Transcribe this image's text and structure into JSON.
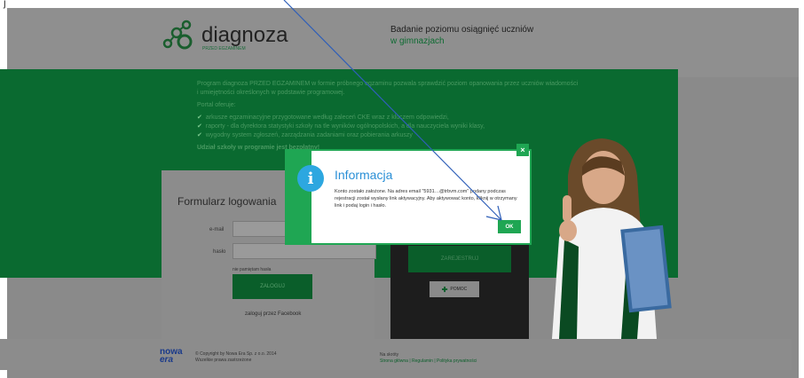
{
  "top_strip": {
    "text": "j"
  },
  "header": {
    "logo_text": "diagnoza",
    "logo_sub": "PRZED EGZAMINEM",
    "tagline_line1": "Badanie poziomu osiągnięć uczniów",
    "tagline_line2": "w gimnazjach"
  },
  "intro": {
    "line1": "Program diagnoza PRZED EGZAMINEM w formie próbnego egzaminu pozwala sprawdzić poziom opanowania przez uczniów wiadomości",
    "line2": "i umiejętności określonych w podstawie programowej.",
    "line3": "Portal oferuje:",
    "bullets": [
      "arkusze egzaminacyjne przygotowane według zaleceń CKE wraz z kluczem odpowiedzi,",
      "raporty - dla dyrektora statystyki szkoły na tle wyników ogólnopolskich, a dla nauczyciela wyniki klasy,",
      "wygodny system zgłoszeń, zarządzania zadaniami oraz pobierania arkuszy"
    ],
    "cta": "Udział szkoły w programie jest bezpłatny!"
  },
  "login": {
    "title": "Formularz logowania",
    "email_label": "e-mail",
    "password_label": "hasło",
    "forgot": "nie pamiętam hasła",
    "submit": "ZALOGUJ",
    "facebook": "zaloguj przez Facebook"
  },
  "register": {
    "button": "ZAREJESTRUJ",
    "help": "POMOC"
  },
  "footer": {
    "brand_line1": "nowa",
    "brand_line2": "era",
    "copyright": "© Copyright by Nowa Era Sp. z o.o. 2014",
    "copyright2": "Wszelkie prawa zastrzeżone",
    "nav_title": "Na skróty",
    "nav_links": "Strona główna  |  Regulamin  |  Polityka prywatności"
  },
  "modal": {
    "title": "Informacja",
    "message": "Konto zostało założone. Na adres email \"5931…@trbvm.com\" podany podczas rejestracji został wysłany link aktywacyjny. Aby aktywować konto, kliknij w otrzymany link i podaj login i hasło.",
    "ok": "OK",
    "close": "×"
  },
  "colors": {
    "accent_green": "#1fa653",
    "info_blue": "#2da7e0",
    "overlay_gray": "#8a8a8a",
    "band_green": "#0a6a30"
  }
}
